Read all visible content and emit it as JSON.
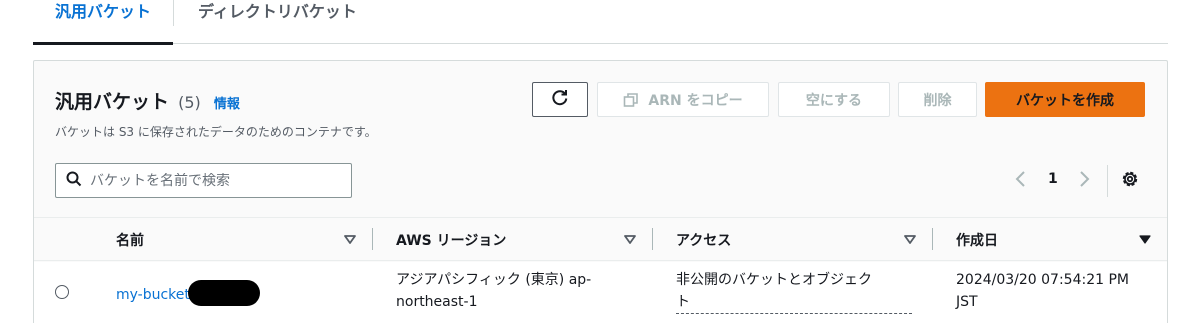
{
  "tabs": [
    {
      "label": "汎用バケット",
      "active": true
    },
    {
      "label": "ディレクトリバケット",
      "active": false
    }
  ],
  "header": {
    "title": "汎用バケット",
    "count": "(5)",
    "info_link": "情報",
    "description": "バケットは S3 に保存されたデータのためのコンテナです。"
  },
  "actions": {
    "refresh_icon": "refresh-icon",
    "copy_arn_label": "ARN をコピー",
    "empty_label": "空にする",
    "delete_label": "削除",
    "create_label": "バケットを作成"
  },
  "search": {
    "placeholder": "バケットを名前で検索",
    "value": ""
  },
  "pagination": {
    "current_page": "1"
  },
  "table": {
    "columns": [
      {
        "label": "名前",
        "sort": "unsorted"
      },
      {
        "label": "AWS リージョン",
        "sort": "unsorted"
      },
      {
        "label": "アクセス",
        "sort": "unsorted"
      },
      {
        "label": "作成日",
        "sort": "descending"
      }
    ],
    "rows": [
      {
        "name": "my-bucket",
        "region": "アジアパシフィック (東京) ap-northeast-1",
        "region_line1": "アジアパシフィック (東京) ap-",
        "region_line2": "northeast-1",
        "access_line1": "非公開のバケットとオブジェク",
        "access_line2": "ト",
        "created_line1": "2024/03/20 07:54:21 PM",
        "created_line2": "JST"
      }
    ]
  },
  "colors": {
    "primary_button": "#ec7211",
    "link": "#0972d3",
    "text": "#16191f",
    "muted": "#545b64",
    "disabled": "#aab7b8"
  }
}
